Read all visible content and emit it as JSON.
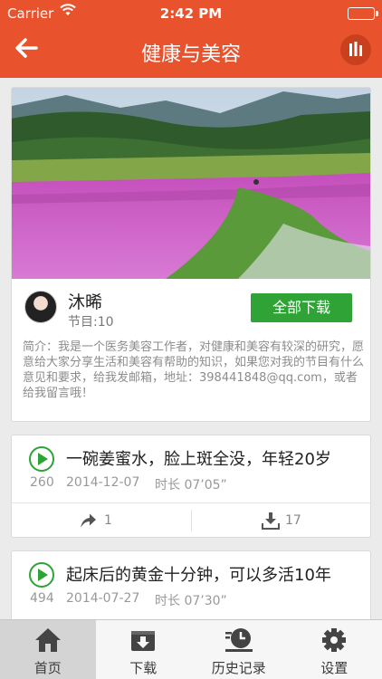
{
  "status_bar": {
    "carrier": "Carrier",
    "time": "2:42 PM"
  },
  "nav": {
    "title": "健康与美容",
    "back_icon": "back-arrow-icon",
    "menu_icon": "bars-icon"
  },
  "colors": {
    "brand": "#e8522d",
    "accent_green": "#2fa336"
  },
  "profile": {
    "name": "沐晞",
    "program_count": "节目:10",
    "download_all_label": "全部下载",
    "bio": "简介：我是一个医务美容工作者，对健康和美容有较深的研究，愿意给大家分享生活和美容有帮助的知识，如果您对我的节目有什么意见和要求，给我发邮箱，地址：398441848@qq.com，或者给我留言哦！"
  },
  "episodes": [
    {
      "title": "一碗姜蜜水，脸上斑全没，年轻20岁",
      "plays": "260",
      "date": "2014-12-07",
      "duration": "时长 07’05”",
      "shares": "1",
      "downloads": "17"
    },
    {
      "title": "起床后的黄金十分钟，可以多活10年",
      "plays": "494",
      "date": "2014-07-27",
      "duration": "时长 07’30”"
    }
  ],
  "tabs": [
    {
      "label": "首页",
      "icon": "home-icon",
      "active": true
    },
    {
      "label": "下载",
      "icon": "download-box-icon",
      "active": false
    },
    {
      "label": "历史记录",
      "icon": "history-icon",
      "active": false
    },
    {
      "label": "设置",
      "icon": "gear-icon",
      "active": false
    }
  ]
}
